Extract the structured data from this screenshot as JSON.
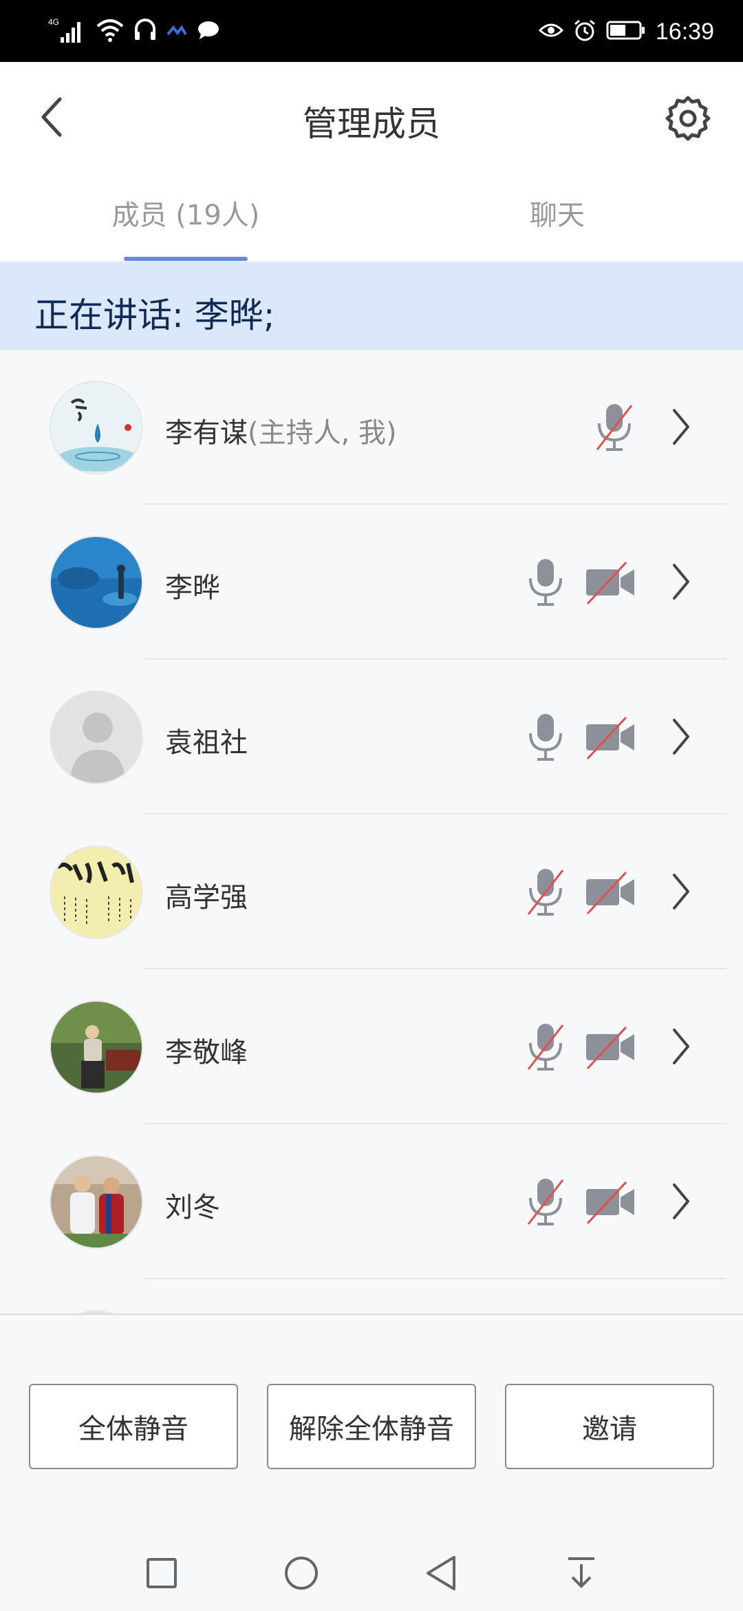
{
  "status_bar": {
    "network": "4G",
    "time": "16:39",
    "icons": [
      "signal-icon",
      "wifi-icon",
      "headset-icon",
      "app-notification-icon",
      "chat-bubble-icon",
      "eye-icon",
      "alarm-icon",
      "battery-icon"
    ]
  },
  "header": {
    "title": "管理成员",
    "back_icon": "chevron-left-icon",
    "settings_icon": "gear-icon"
  },
  "tabs": [
    {
      "label": "成员 (19人)",
      "active": true
    },
    {
      "label": "聊天",
      "active": false
    }
  ],
  "speaking": {
    "text": "正在讲话: 李晔;"
  },
  "members": [
    {
      "name": "李有谋",
      "role": "(主持人, 我)",
      "mic": "muted",
      "camera": "none",
      "avatar": "calligraphy-water-drop"
    },
    {
      "name": "李晔",
      "role": "",
      "mic": "on",
      "camera": "off",
      "avatar": "aquarium-photo"
    },
    {
      "name": "袁祖社",
      "role": "",
      "mic": "on",
      "camera": "off",
      "avatar": "default-person"
    },
    {
      "name": "高学强",
      "role": "",
      "mic": "muted",
      "camera": "off",
      "avatar": "calligraphy-scroll"
    },
    {
      "name": "李敬峰",
      "role": "",
      "mic": "muted",
      "camera": "off",
      "avatar": "park-photo"
    },
    {
      "name": "刘冬",
      "role": "",
      "mic": "muted",
      "camera": "off",
      "avatar": "football-photo"
    }
  ],
  "actions": {
    "mute_all": "全体静音",
    "unmute_all": "解除全体静音",
    "invite": "邀请"
  },
  "nav": {
    "icons": [
      "recent-apps-icon",
      "home-icon",
      "back-icon",
      "notification-pulldown-icon"
    ]
  },
  "colors": {
    "accent": "#6e8ad4",
    "banner_bg": "#dbe8fb",
    "banner_text": "#0e2a55",
    "muted_red": "#e0504d",
    "icon_gray": "#8e9099"
  }
}
